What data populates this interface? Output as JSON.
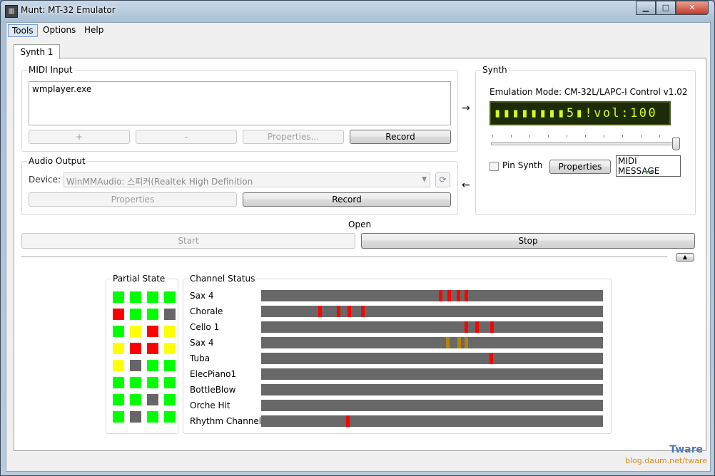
{
  "window": {
    "title": "Munt: MT-32 Emulator",
    "controls": {
      "minimize": "▁",
      "maximize": "□",
      "close": "✕"
    }
  },
  "menu": [
    "Tools",
    "Options",
    "Help"
  ],
  "tab": {
    "label": "Synth 1"
  },
  "midi_input": {
    "label": "MIDI Input",
    "sources": [
      "wmplayer.exe"
    ],
    "buttons": {
      "add": "+",
      "remove": "-",
      "properties": "Properties...",
      "record": "Record"
    }
  },
  "arrows": {
    "to_synth": "→",
    "from_synth": "←"
  },
  "audio_output": {
    "label": "Audio Output",
    "device_label": "Device:",
    "device_value": "WinMMAudio: 스피커(Realtek High Definition",
    "buttons": {
      "properties": "Properties",
      "record": "Record"
    }
  },
  "synth": {
    "label": "Synth",
    "emulation_mode": "Emulation Mode: CM-32L/LAPC-I Control v1.02",
    "lcd_text": "▮▮▮▮▮▮▮▮5▮!vol:100",
    "volume": 100,
    "pin_label": "Pin Synth",
    "pinned": false,
    "properties_button": "Properties",
    "midi_message": "MIDI MESSAGE"
  },
  "status": "Open",
  "controls": {
    "start": "Start",
    "stop": "Stop",
    "collapse": "▲"
  },
  "partial_state": {
    "label": "Partial State",
    "colors": {
      "G": "#00ff00",
      "R": "#ff0000",
      "Y": "#ffff00",
      "D": "#666666"
    },
    "grid": [
      [
        "G",
        "G",
        "G",
        "G"
      ],
      [
        "R",
        "G",
        "G",
        "D"
      ],
      [
        "G",
        "Y",
        "R",
        "Y"
      ],
      [
        "Y",
        "R",
        "R",
        "Y"
      ],
      [
        "Y",
        "D",
        "G",
        "G"
      ],
      [
        "G",
        "G",
        "G",
        "G"
      ],
      [
        "G",
        "G",
        "D",
        "G"
      ],
      [
        "G",
        "D",
        "G",
        "G"
      ]
    ]
  },
  "channel_status": {
    "label": "Channel Status",
    "channels": [
      {
        "name": "Sax 4",
        "notes": [
          {
            "pos": 0.52,
            "c": "#ff0000"
          },
          {
            "pos": 0.545,
            "c": "#ff0000"
          },
          {
            "pos": 0.572,
            "c": "#ff0000"
          },
          {
            "pos": 0.595,
            "c": "#ff0000"
          }
        ]
      },
      {
        "name": "Chorale",
        "notes": [
          {
            "pos": 0.168,
            "c": "#ff0000"
          },
          {
            "pos": 0.222,
            "c": "#ff0000"
          },
          {
            "pos": 0.252,
            "c": "#ff0000"
          },
          {
            "pos": 0.293,
            "c": "#ff0000"
          }
        ]
      },
      {
        "name": "Cello 1",
        "notes": [
          {
            "pos": 0.595,
            "c": "#ff0000"
          },
          {
            "pos": 0.627,
            "c": "#ff0000"
          },
          {
            "pos": 0.67,
            "c": "#ff0000"
          }
        ]
      },
      {
        "name": "Sax 4",
        "notes": [
          {
            "pos": 0.54,
            "c": "#b5830b"
          },
          {
            "pos": 0.575,
            "c": "#b5830b"
          },
          {
            "pos": 0.595,
            "c": "#b5830b"
          }
        ]
      },
      {
        "name": "Tuba",
        "notes": [
          {
            "pos": 0.668,
            "c": "#ff0000"
          }
        ]
      },
      {
        "name": "ElecPiano1",
        "notes": []
      },
      {
        "name": "BottleBlow",
        "notes": []
      },
      {
        "name": "Orche Hit",
        "notes": []
      },
      {
        "name": "Rhythm Channel",
        "notes": [
          {
            "pos": 0.248,
            "c": "#ff0000"
          }
        ]
      }
    ]
  },
  "watermark": {
    "brand": "Tware",
    "url": "blog.daum.net/tware"
  }
}
